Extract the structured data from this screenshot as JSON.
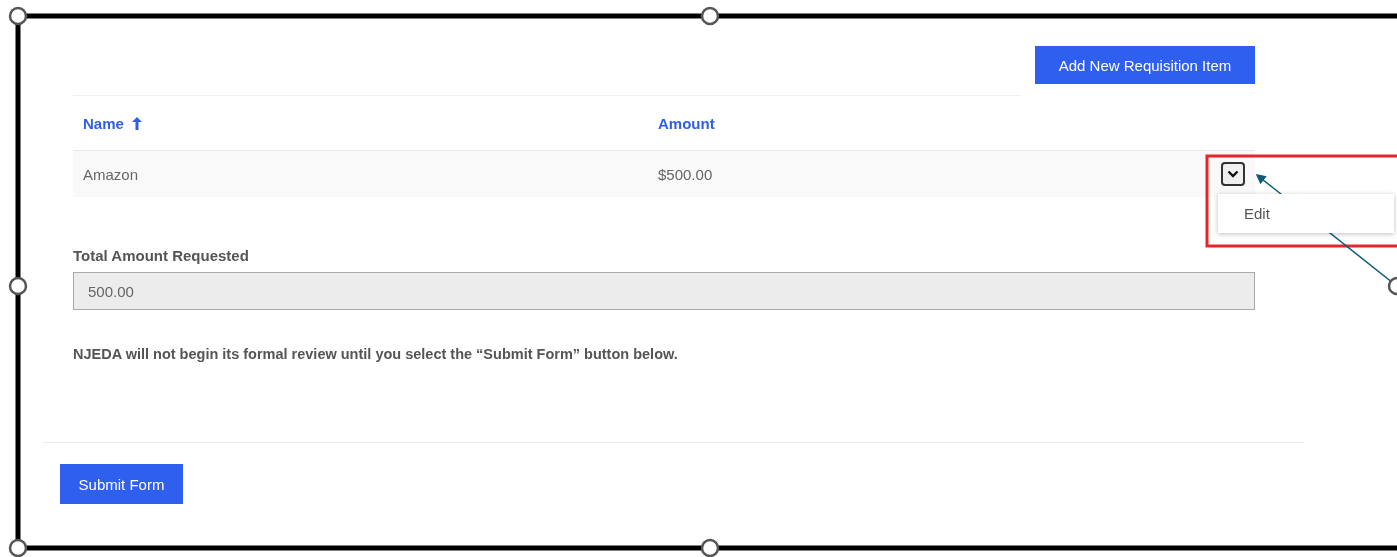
{
  "add_button": "Add New Requisition Item",
  "table": {
    "columns": [
      {
        "label": "Name",
        "sorted": true
      },
      {
        "label": "Amount"
      }
    ],
    "rows": [
      {
        "name": "Amazon",
        "amount": "$500.00"
      }
    ]
  },
  "row_menu": {
    "expanded": true,
    "items": [
      "Edit"
    ]
  },
  "total": {
    "label": "Total Amount Requested",
    "value": "500.00"
  },
  "notice": "NJEDA will not begin its formal review until you select the “Submit Form” button below.",
  "submit_button": "Submit Form"
}
